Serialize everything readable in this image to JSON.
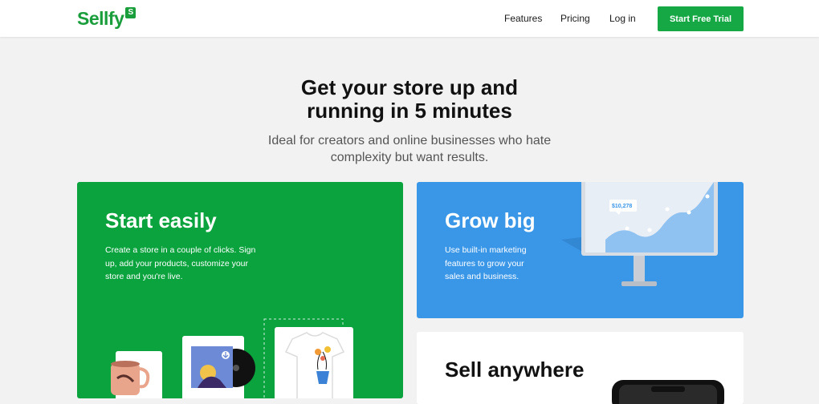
{
  "header": {
    "logo_text": "Sellfy",
    "logo_badge": "S",
    "nav": [
      "Features",
      "Pricing",
      "Log in"
    ],
    "cta": "Start Free Trial"
  },
  "hero": {
    "title_line1": "Get your store up and",
    "title_line2": "running in 5 minutes",
    "subtitle_line1": "Ideal for creators and online businesses who hate",
    "subtitle_line2": "complexity but want results."
  },
  "cards": {
    "start": {
      "title": "Start easily",
      "text": "Create a store in a couple of clicks. Sign up, add your products, customize your store and you're live."
    },
    "grow": {
      "title": "Grow big",
      "text": "Use built-in marketing features to grow your sales and business.",
      "chart_badge": "$10,278"
    },
    "sell": {
      "title": "Sell anywhere"
    }
  },
  "colors": {
    "brand_green": "#16a844",
    "card_green": "#0aa33d",
    "card_blue": "#3a97e8"
  }
}
